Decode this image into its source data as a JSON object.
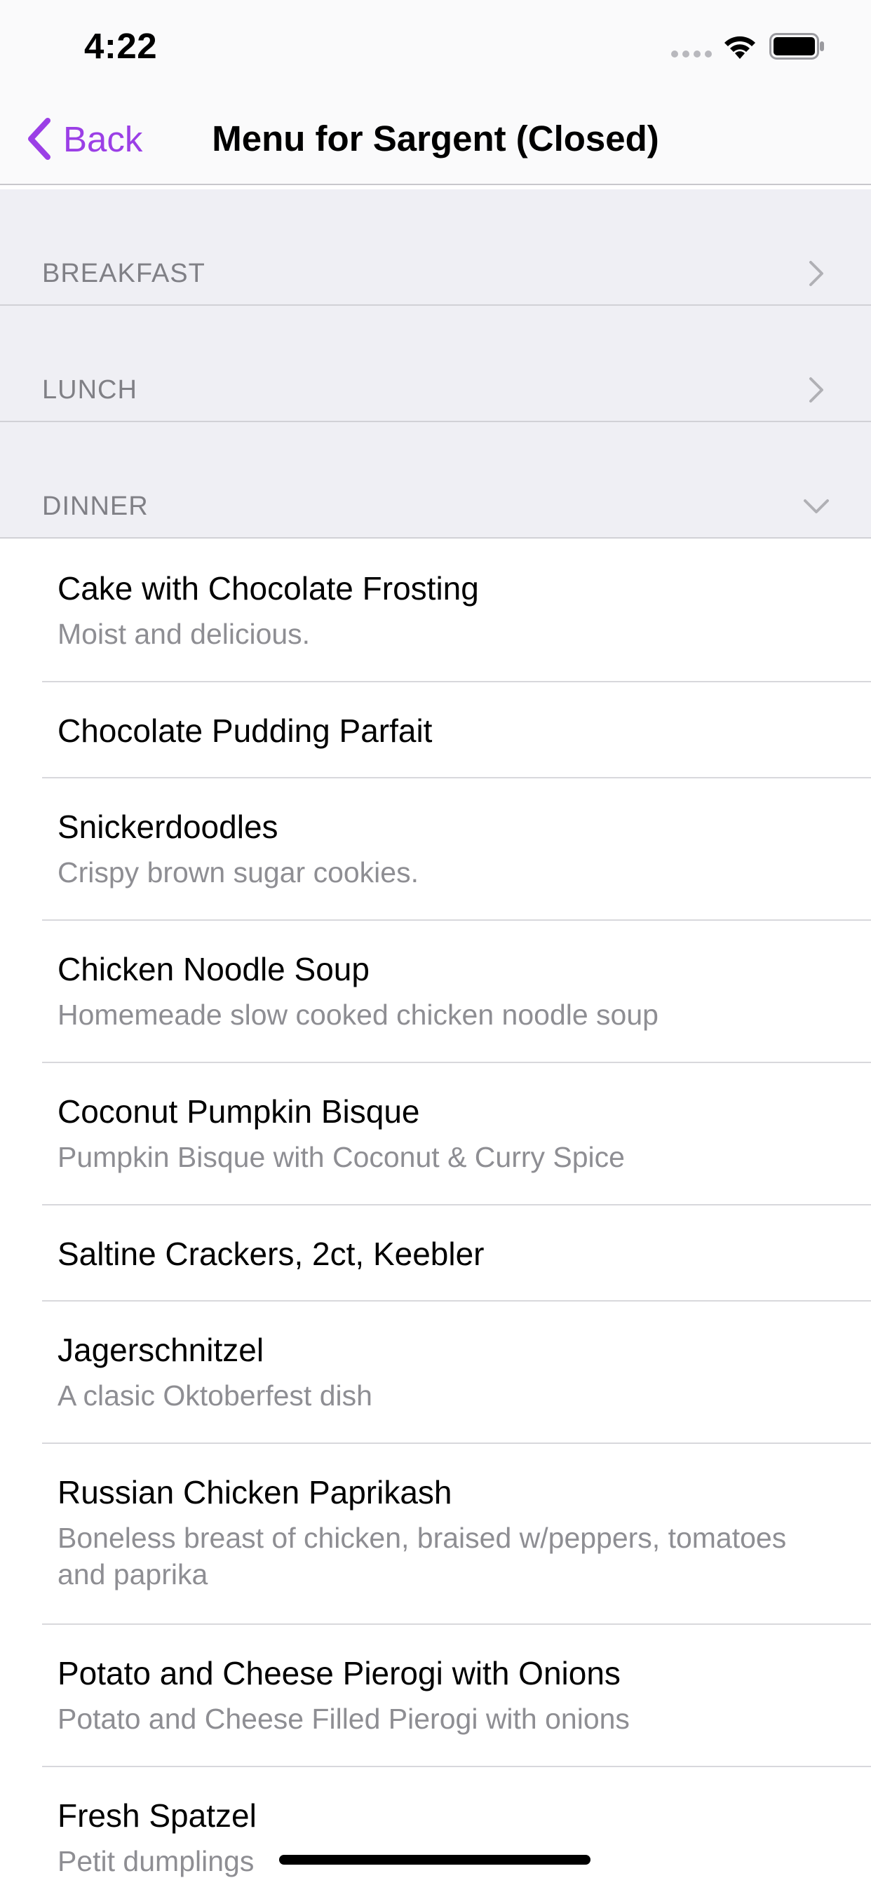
{
  "status_bar": {
    "time": "4:22",
    "icons": [
      "signal-icon",
      "wifi-icon",
      "battery-icon"
    ]
  },
  "nav": {
    "back_label": "Back",
    "title": "Menu for Sargent (Closed)",
    "accent_color": "#9b3fe6"
  },
  "sections": [
    {
      "label": "BREAKFAST",
      "state": "collapsed",
      "icon": "chevron-right-icon"
    },
    {
      "label": "LUNCH",
      "state": "collapsed",
      "icon": "chevron-right-icon"
    },
    {
      "label": "DINNER",
      "state": "expanded",
      "icon": "chevron-down-icon"
    }
  ],
  "dinner_items": [
    {
      "name": "Cake with Chocolate Frosting",
      "description": "Moist and delicious."
    },
    {
      "name": "Chocolate Pudding Parfait",
      "description": ""
    },
    {
      "name": "Snickerdoodles",
      "description": "Crispy brown sugar cookies."
    },
    {
      "name": "Chicken Noodle Soup",
      "description": "Homemeade slow cooked chicken noodle soup"
    },
    {
      "name": "Coconut Pumpkin Bisque",
      "description": "Pumpkin Bisque with Coconut & Curry Spice"
    },
    {
      "name": "Saltine Crackers, 2ct, Keebler",
      "description": ""
    },
    {
      "name": "Jagerschnitzel",
      "description": "A clasic Oktoberfest dish"
    },
    {
      "name": "Russian Chicken Paprikash",
      "description": "Boneless breast of chicken, braised w/peppers, tomatoes and paprika"
    },
    {
      "name": "Potato and Cheese Pierogi with Onions",
      "description": "Potato and Cheese Filled Pierogi with onions"
    },
    {
      "name": "Fresh Spatzel",
      "description": "Petit dumplings"
    }
  ]
}
